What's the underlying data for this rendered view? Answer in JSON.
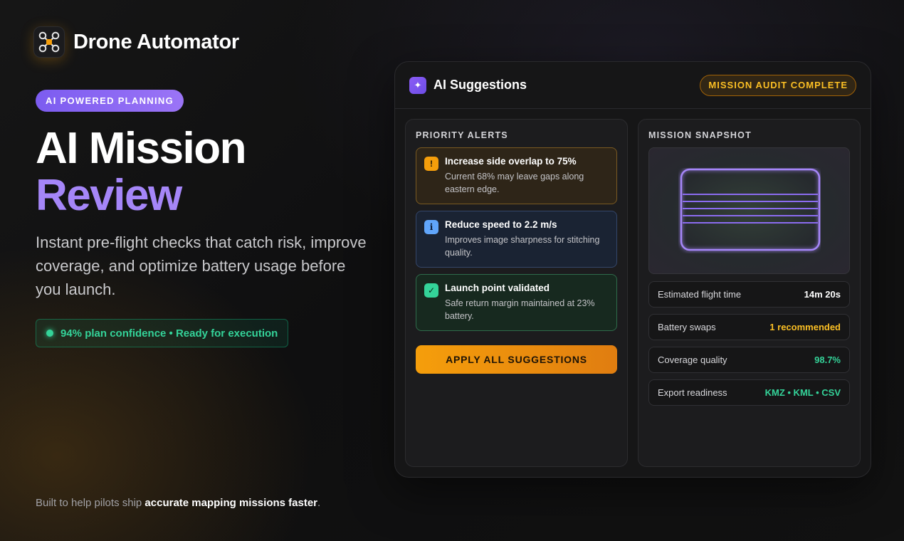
{
  "brand": {
    "name": "Drone Automator",
    "logo_icon": "drone-icon"
  },
  "hero": {
    "badge": "AI POWERED PLANNING",
    "title_line1": "AI Mission",
    "title_line2": "Review",
    "subtitle": "Instant pre-flight checks that catch risk, improve coverage, and optimize battery usage before you launch.",
    "confidence": "94% plan confidence • Ready for execution"
  },
  "panel": {
    "title": "AI Suggestions",
    "icon": "sparkle-icon",
    "status_badge": "MISSION AUDIT COMPLETE",
    "priority_alerts": {
      "heading": "PRIORITY ALERTS",
      "items": [
        {
          "type": "warning",
          "icon": "exclamation-icon",
          "icon_glyph": "!",
          "title": "Increase side overlap to 75%",
          "text": "Current 68% may leave gaps along eastern edge."
        },
        {
          "type": "info",
          "icon": "info-icon",
          "icon_glyph": "i",
          "title": "Reduce speed to 2.2 m/s",
          "text": "Improves image sharpness for stitching quality."
        },
        {
          "type": "success",
          "icon": "check-icon",
          "icon_glyph": "✓",
          "title": "Launch point validated",
          "text": "Safe return margin maintained at 23% battery."
        }
      ],
      "apply_button": "APPLY ALL SUGGESTIONS"
    },
    "snapshot": {
      "heading": "MISSION SNAPSHOT",
      "stats": [
        {
          "label": "Estimated flight time",
          "value": "14m 20s",
          "color": "#ffffff"
        },
        {
          "label": "Battery swaps",
          "value": "1 recommended",
          "color": "#fbbf24"
        },
        {
          "label": "Coverage quality",
          "value": "98.7%",
          "color": "#34d399"
        },
        {
          "label": "Export readiness",
          "value": "KMZ • KML • CSV",
          "color": "#34d399"
        }
      ]
    }
  },
  "footer": {
    "prefix": "Built to help pilots ship ",
    "bold": "accurate mapping missions faster",
    "suffix": "."
  },
  "colors": {
    "accent_purple": "#a586f8",
    "accent_amber": "#f59e0b",
    "accent_green": "#34d399",
    "info_blue": "#60a5fa"
  }
}
